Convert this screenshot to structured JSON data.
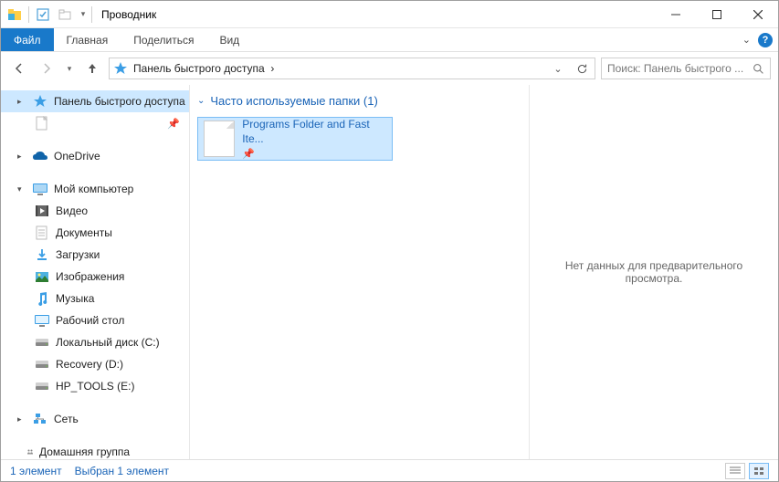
{
  "title": "Проводник",
  "ribbon": {
    "file": "Файл",
    "tabs": [
      "Главная",
      "Поделиться",
      "Вид"
    ]
  },
  "address": {
    "location": "Панель быстрого доступа",
    "separator": "›"
  },
  "search": {
    "placeholder": "Поиск: Панель быстрого ..."
  },
  "sidebar": {
    "quick_access": "Панель быстрого доступа",
    "onedrive": "OneDrive",
    "my_computer": "Мой компьютер",
    "items": {
      "video": "Видео",
      "documents": "Документы",
      "downloads": "Загрузки",
      "pictures": "Изображения",
      "music": "Музыка",
      "desktop": "Рабочий стол",
      "local_c": "Локальный диск (C:)",
      "recovery": "Recovery (D:)",
      "hp_tools": "HP_TOOLS (E:)"
    },
    "network": "Сеть",
    "homegroup": "Домашняя группа"
  },
  "content": {
    "group_title": "Часто используемые папки (1)",
    "folder_name": "Programs Folder and Fast Ite..."
  },
  "preview": {
    "empty_text": "Нет данных для предварительного просмотра."
  },
  "status": {
    "count": "1 элемент",
    "selection": "Выбран 1 элемент"
  }
}
